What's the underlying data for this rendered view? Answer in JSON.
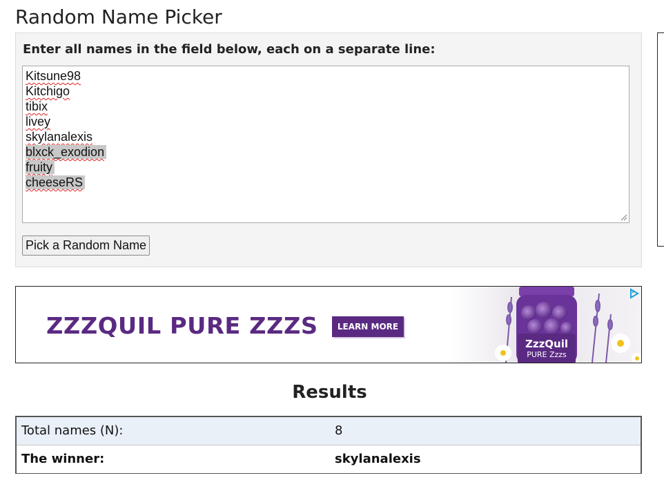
{
  "page": {
    "title": "Random Name Picker"
  },
  "picker": {
    "instructions": "Enter all names in the field below, each on a separate line:",
    "names": [
      "Kitsune98",
      "Kitchigo",
      "tibix",
      "livey",
      "skylanalexis",
      "blxck_exodion",
      "fruity",
      "cheeseRS"
    ],
    "button_label": "Pick a Random Name"
  },
  "ad": {
    "headline": "ZZZQUIL PURE ZZZS",
    "cta_label": "LEARN MORE",
    "product_brand": "ZzzQuil",
    "product_line": "PURE Zzzs",
    "brand_color": "#5a2a82"
  },
  "results": {
    "title": "Results",
    "rows": [
      {
        "label": "Total names (N):",
        "value": "8"
      },
      {
        "label": "The winner:",
        "value": "skylanalexis"
      }
    ]
  }
}
